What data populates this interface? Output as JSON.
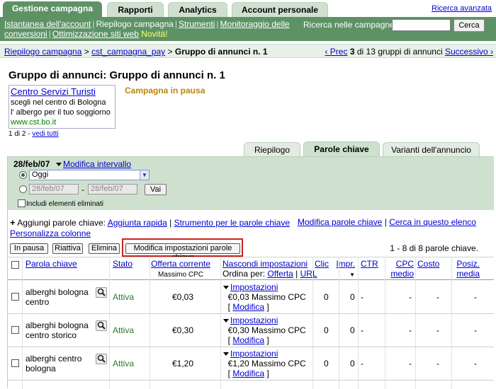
{
  "top_tabs": [
    "Gestione campagna",
    "Rapporti",
    "Analytics",
    "Account personale"
  ],
  "advanced_search": "Ricerca avanzata",
  "nav": {
    "links": [
      "Istantanea dell'account",
      "Riepilogo campagna",
      "Strumenti",
      "Monitoraggio delle conversioni",
      "Ottimizzazione siti web"
    ],
    "novita": "Novità!",
    "search_label": "Ricerca nelle campagne:",
    "search_value": "",
    "search_button": "Cerca"
  },
  "breadcrumb": {
    "root": "Riepilogo campagna",
    "campaign": "cst_campagna_pay",
    "current": "Gruppo di annunci n. 1",
    "prev": "‹ Prec",
    "position": "3",
    "position_text": "di 13 gruppi di annunci",
    "next": "Successivo ›"
  },
  "page_title": "Gruppo di annunci: Gruppo di annunci n. 1",
  "ad": {
    "headline": "Centro Servizi Turisti",
    "line1": "scegli nel centro di Bologna",
    "line2": "l' albergo per il tuo soggiorno",
    "url": "www.cst.bo.it"
  },
  "campaign_status": "Campagna in pausa",
  "ad_count": "1 di 2 -",
  "ad_view_all": "vedi tutti",
  "sub_tabs": [
    "Riepilogo",
    "Parole chiave",
    "Varianti dell'annuncio"
  ],
  "date": {
    "label": "28/feb/07",
    "modify": "Modifica intervallo",
    "selected_range": "Oggi",
    "from": "28/feb/07",
    "to": "28/feb/07",
    "sep": "-",
    "go": "Vai",
    "include_deleted": "Includi elementi eliminati"
  },
  "tools": {
    "add_prefix": "Aggiungi parole chiave:",
    "quick_add": "Aggiunta rapida",
    "kw_tool": "Strumento per le parole chiave",
    "edit_kw": "Modifica parole chiave",
    "search_list": "Cerca in questo elenco",
    "customize": "Personalizza colonne"
  },
  "buttons": [
    "In pausa",
    "Riattiva",
    "Elimina",
    "Modifica impostazioni parole chiave"
  ],
  "count_text": "1 - 8 di 8 parole chiave.",
  "columns": {
    "keyword": "Parola chiave",
    "status": "Stato",
    "bid": "Offerta corrente",
    "bid_sub": "Massimo CPC",
    "settings": "Nascondi impostazioni",
    "order_by": "Ordina per:",
    "order_offer": "Offerta",
    "order_url": "URL",
    "clicks": "Clic",
    "impr": "Impr.",
    "ctr": "CTR",
    "cpc": "CPC medio",
    "cost": "Costo",
    "pos": "Posiz. media"
  },
  "rows": [
    {
      "kw1": "alberghi bologna",
      "kw2": "centro",
      "status": "Attiva",
      "bid": "€0,03",
      "settings": "Impostazioni",
      "max": "€0,03 Massimo CPC",
      "modify": "Modifica",
      "clicks": "0",
      "impr": "0",
      "ctr": "-",
      "cpc": "-",
      "cost": "-",
      "pos": "-"
    },
    {
      "kw1": "alberghi bologna",
      "kw2": "centro storico",
      "status": "Attiva",
      "bid": "€0,30",
      "settings": "Impostazioni",
      "max": "€0,30 Massimo CPC",
      "modify": "Modifica",
      "clicks": "0",
      "impr": "0",
      "ctr": "-",
      "cpc": "-",
      "cost": "-",
      "pos": "-"
    },
    {
      "kw1": "alberghi centro",
      "kw2": "bologna",
      "status": "Attiva",
      "bid": "€1,20",
      "settings": "Impostazioni",
      "max": "€1,20 Massimo CPC",
      "modify": "Modifica",
      "clicks": "0",
      "impr": "0",
      "ctr": "-",
      "cpc": "-",
      "cost": "-",
      "pos": "-"
    }
  ]
}
